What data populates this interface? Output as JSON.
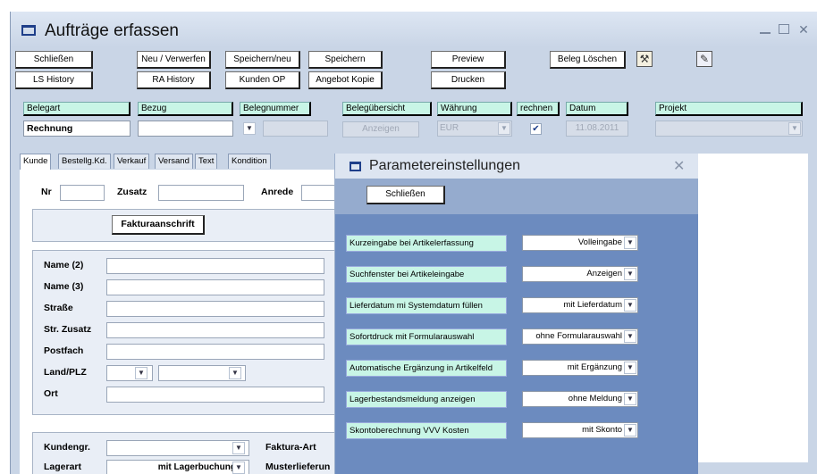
{
  "window": {
    "title": "Aufträge erfassen"
  },
  "toolbar_row1": [
    "Schließen",
    "Neu / Verwerfen",
    "Speichern/neu",
    "Speichern",
    "Preview",
    "Beleg Löschen"
  ],
  "toolbar_row2": [
    "LS History",
    "RA History",
    "Kunden OP",
    "Angebot Kopie",
    "Drucken"
  ],
  "toolbar_icons": [
    "tools-icon",
    "delete-document-icon"
  ],
  "header_labels": {
    "belegart": "Belegart",
    "bezug": "Bezug",
    "belegnummer": "Belegnummer",
    "beleguebersicht": "Belegübersicht",
    "waehrung": "Währung",
    "rechnen": "rechnen",
    "datum": "Datum",
    "projekt": "Projekt"
  },
  "header_values": {
    "belegart": "Rechnung",
    "bezug": "",
    "belegnummer": "",
    "anzeigen_button": "Anzeigen",
    "waehrung": "EUR",
    "rechnen_checked": true,
    "datum": "11.08.2011",
    "projekt": ""
  },
  "tabs": [
    "Kunde",
    "Bestellg.Kd.",
    "Verkauf",
    "Versand",
    "Text",
    "Kondition"
  ],
  "active_tab": "Kunde",
  "kunde_form": {
    "nr": "Nr",
    "zusatz": "Zusatz",
    "anrede": "Anrede",
    "fakturaanschrift": "Fakturaanschrift",
    "name2": "Name (2)",
    "name3": "Name (3)",
    "strasse": "Straße",
    "str_zusatz": "Str. Zusatz",
    "postfach": "Postfach",
    "land_plz": "Land/PLZ",
    "ort": "Ort",
    "kundengr": "Kundengr.",
    "faktura_art": "Faktura-Art",
    "lagerart": "Lagerart",
    "lagerart_value": "mit Lagerbuchung",
    "musterlieferung": "Musterlieferun"
  },
  "dialog": {
    "title": "Parametereinstellungen",
    "close_button": "Schließen",
    "params": [
      {
        "label": "Kurzeingabe bei Artikelerfassung",
        "value": "Volleingabe"
      },
      {
        "label": "Suchfenster bei Artikeleingabe",
        "value": "Anzeigen"
      },
      {
        "label": "Lieferdatum mi Systemdatum füllen",
        "value": "mit Lieferdatum"
      },
      {
        "label": "Sofortdruck mit Formularauswahl",
        "value": "ohne Formularauswahl"
      },
      {
        "label": "Automatische Ergänzung in Artikelfeld",
        "value": "mit  Ergänzung"
      },
      {
        "label": "Lagerbestandsmeldung anzeigen",
        "value": "ohne Meldung"
      },
      {
        "label": "Skontoberechnung VVV Kosten",
        "value": "mit Skonto"
      }
    ]
  },
  "colors": {
    "window_bg": "#c9d5e6",
    "label_bg": "#c8f5e6",
    "dialog_body": "#6c8bbf",
    "dialog_top": "#95abce"
  }
}
